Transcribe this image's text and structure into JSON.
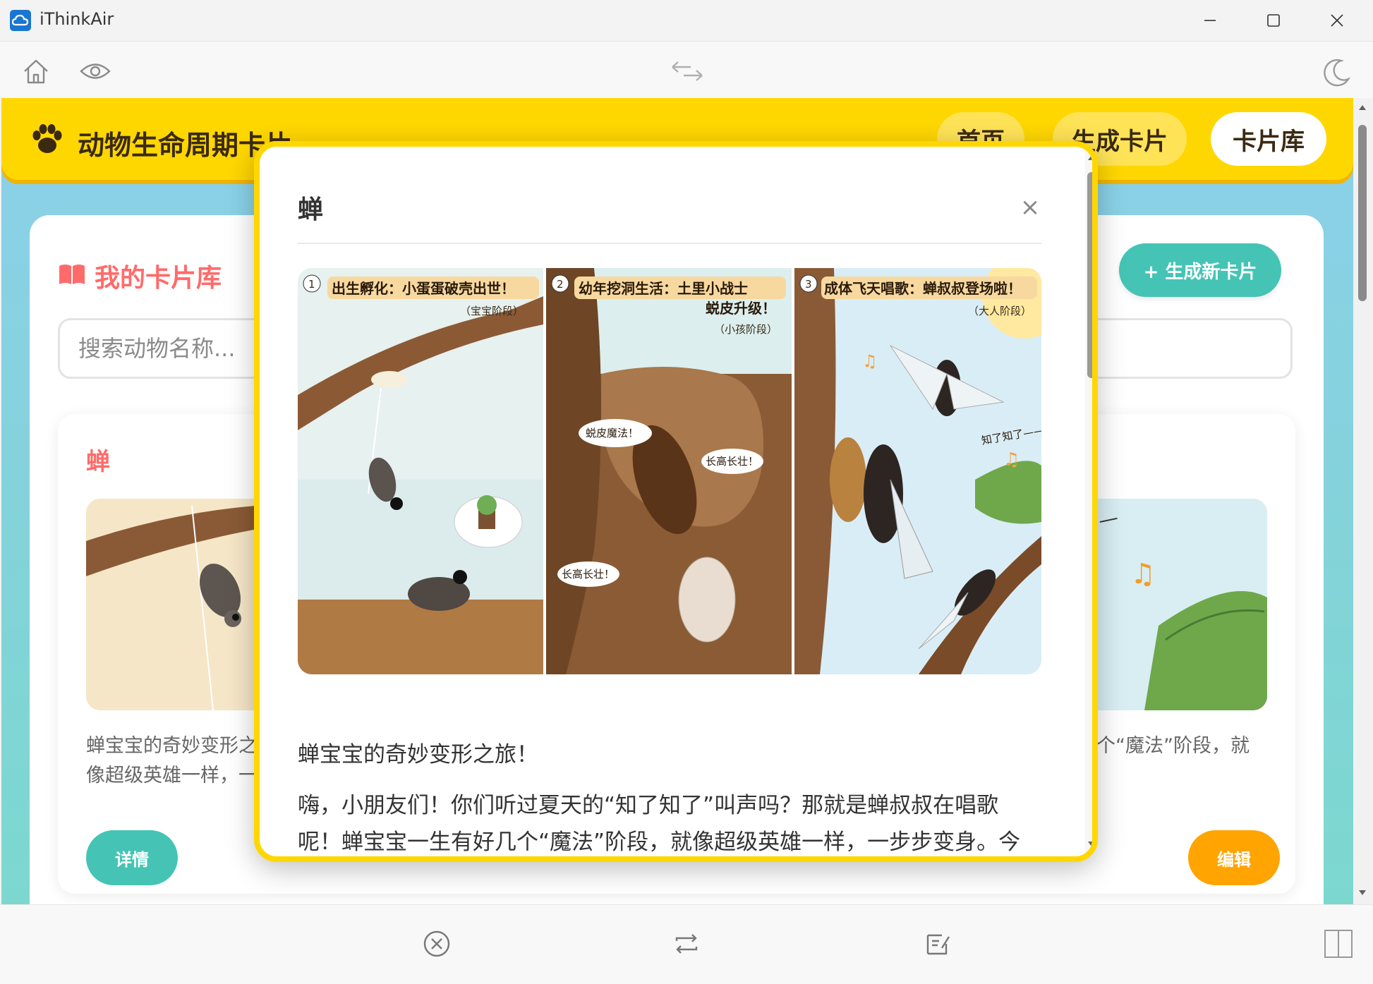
{
  "window": {
    "title": "iThinkAir"
  },
  "site": {
    "title": "动物生命周期卡片"
  },
  "nav": {
    "home": "首页",
    "generate": "生成卡片",
    "library": "卡片库"
  },
  "library": {
    "title": "我的卡片库",
    "new_card_label": "+ 生成新卡片",
    "search_placeholder": "搜索动物名称..."
  },
  "card": {
    "title": "蝉",
    "summary": "蝉宝宝的奇妙变形之旅！嗨，小朋友们！你们听过夏天的“知了知了”叫声吗？那就是蝉叔叔在唱歌呢！蝉宝宝一生有好几个“魔法”阶段，就像超级英雄一样，一步步变身。",
    "detail_label": "详情",
    "edit_label": "编辑",
    "thumb_text": "知了知了——"
  },
  "modal": {
    "title": "蝉",
    "close_glyph": "×",
    "subtitle": "蝉宝宝的奇妙变形之旅！",
    "body": "嗨，小朋友们！你们听过夏天的“知了知了”叫声吗？那就是蝉叔叔在唱歌呢！蝉宝宝一生有好几个“魔法”阶段，就像超级英雄一样，一步步变身。今天我们就一起来看看蝉宝宝是怎样长大的吧！",
    "comic": {
      "panel1": {
        "num": "1",
        "caption": "出生孵化：小蛋蛋破壳出世！",
        "stage": "（宝宝阶段）"
      },
      "panel2": {
        "num": "2",
        "caption_line1": "幼年挖洞生活：土里小战士",
        "caption_line2": "蜕皮升级！",
        "stage": "（小孩阶段）",
        "bubble1": "蜕皮魔法！",
        "bubble2": "长高长壮！",
        "bubble3": "长高长壮！"
      },
      "panel3": {
        "num": "3",
        "caption": "成体飞天唱歌：蝉叔叔登场啦！",
        "stage": "（大人阶段）",
        "song": "知了知了——"
      }
    }
  },
  "colors": {
    "header": "#ffd700",
    "accent_red": "#ff6b6b",
    "teal": "#45c4b5",
    "orange": "#ffa400"
  },
  "icons": {
    "toolbar": [
      "home-icon",
      "eye-icon",
      "swap-icon",
      "moon-icon"
    ],
    "bottom": [
      "close-circle-icon",
      "repeat-icon",
      "edit-note-icon",
      "split-view-icon"
    ]
  }
}
